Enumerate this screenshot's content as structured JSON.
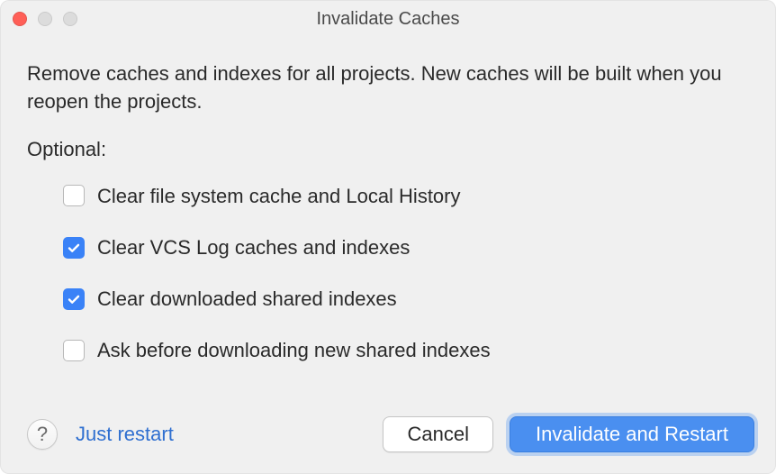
{
  "titlebar": {
    "title": "Invalidate Caches"
  },
  "content": {
    "description": "Remove caches and indexes for all projects. New caches will be built when you reopen the projects.",
    "optional_label": "Optional:",
    "options": [
      {
        "label": "Clear file system cache and Local History",
        "checked": false
      },
      {
        "label": "Clear VCS Log caches and indexes",
        "checked": true
      },
      {
        "label": "Clear downloaded shared indexes",
        "checked": true
      },
      {
        "label": "Ask before downloading new shared indexes",
        "checked": false
      }
    ]
  },
  "footer": {
    "help": "?",
    "just_restart": "Just restart",
    "cancel": "Cancel",
    "primary": "Invalidate and Restart"
  }
}
